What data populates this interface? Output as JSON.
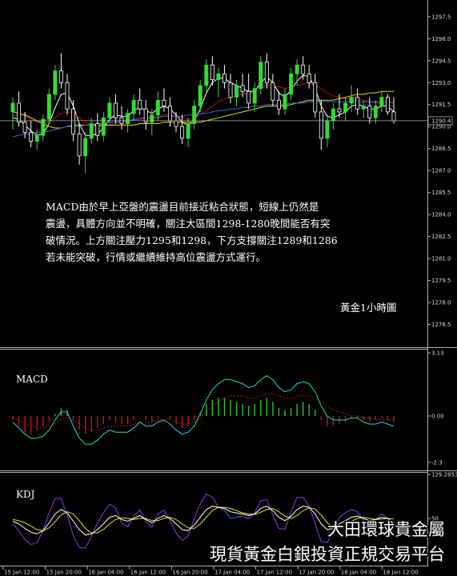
{
  "chart_data": [
    {
      "type": "candlestick",
      "title": "黃金1小時圖",
      "annotation": "MACD由於早上亞盤的震盪目前接近粘合狀態，短線上仍然是震盪，具體方向並不明確，關注大區間1298-1280晚間能否有突破情況。上方關注壓力1295和1298，下方支撐關注1289和1286若未能突破，行情或繼續維持高位震盪方式運行。",
      "annotation_lines": [
        "MACD由於早上亞盤的震盪目前接近粘合狀態，短線上仍然是",
        "震盪，具體方向並不明確，關注大區間1298-1280晚間能否有突",
        "破情況。上方關注壓力1295和1298，下方支撐關注1289和1286",
        "若未能突破，行情或繼續維持高位震盪方式運行。"
      ],
      "y_ticks": [
        "1297.5",
        "1296.0",
        "1294.5",
        "1293.0",
        "1291.5",
        "1290.0",
        "1288.5",
        "1287.0",
        "1285.5",
        "1284.0",
        "1282.5",
        "1281.0",
        "1279.5",
        "1278.0",
        "1276.5"
      ],
      "ylim": [
        1275.6,
        1298.2
      ],
      "current_price": "1290.4",
      "current_price_value": 1290.4,
      "x_ticks": [
        "15 Jan 12:00",
        "15 Jan 20:00",
        "16 Jan 04:00",
        "16 Jan 12:00",
        "16 Jan 20:00",
        "17 Jan 04:00",
        "17 Jan 12:00",
        "17 Jan 20:00",
        "18 Jan 04:00",
        "18 Jan 12:00"
      ],
      "candles": [
        {
          "o": 1291.0,
          "h": 1292.0,
          "l": 1289.8,
          "c": 1291.6
        },
        {
          "o": 1291.6,
          "h": 1292.4,
          "l": 1290.0,
          "c": 1290.3
        },
        {
          "o": 1290.3,
          "h": 1291.0,
          "l": 1289.2,
          "c": 1289.6
        },
        {
          "o": 1289.6,
          "h": 1290.4,
          "l": 1288.6,
          "c": 1289.0
        },
        {
          "o": 1289.0,
          "h": 1289.8,
          "l": 1288.4,
          "c": 1289.4
        },
        {
          "o": 1289.4,
          "h": 1290.8,
          "l": 1289.0,
          "c": 1290.5
        },
        {
          "o": 1290.5,
          "h": 1292.6,
          "l": 1290.2,
          "c": 1292.2
        },
        {
          "o": 1292.2,
          "h": 1294.2,
          "l": 1291.8,
          "c": 1293.8
        },
        {
          "o": 1293.8,
          "h": 1295.0,
          "l": 1292.6,
          "c": 1293.0
        },
        {
          "o": 1293.0,
          "h": 1293.6,
          "l": 1290.8,
          "c": 1291.2
        },
        {
          "o": 1291.2,
          "h": 1291.8,
          "l": 1289.0,
          "c": 1289.5
        },
        {
          "o": 1289.5,
          "h": 1290.2,
          "l": 1287.4,
          "c": 1288.0
        },
        {
          "o": 1288.0,
          "h": 1289.6,
          "l": 1286.8,
          "c": 1289.2
        },
        {
          "o": 1289.2,
          "h": 1290.6,
          "l": 1288.8,
          "c": 1290.2
        },
        {
          "o": 1290.2,
          "h": 1290.9,
          "l": 1289.0,
          "c": 1289.4
        },
        {
          "o": 1289.4,
          "h": 1291.0,
          "l": 1289.0,
          "c": 1290.6
        },
        {
          "o": 1290.6,
          "h": 1292.0,
          "l": 1290.2,
          "c": 1291.6
        },
        {
          "o": 1291.6,
          "h": 1292.2,
          "l": 1290.2,
          "c": 1290.6
        },
        {
          "o": 1290.6,
          "h": 1291.4,
          "l": 1289.8,
          "c": 1290.2
        },
        {
          "o": 1290.2,
          "h": 1291.2,
          "l": 1289.6,
          "c": 1290.9
        },
        {
          "o": 1290.9,
          "h": 1292.2,
          "l": 1290.4,
          "c": 1291.8
        },
        {
          "o": 1291.8,
          "h": 1292.6,
          "l": 1290.8,
          "c": 1291.2
        },
        {
          "o": 1291.2,
          "h": 1291.8,
          "l": 1289.8,
          "c": 1290.3
        },
        {
          "o": 1290.3,
          "h": 1291.2,
          "l": 1289.4,
          "c": 1290.8
        },
        {
          "o": 1290.8,
          "h": 1292.4,
          "l": 1290.4,
          "c": 1291.8
        },
        {
          "o": 1291.8,
          "h": 1292.6,
          "l": 1291.0,
          "c": 1291.4
        },
        {
          "o": 1291.4,
          "h": 1292.0,
          "l": 1290.0,
          "c": 1290.4
        },
        {
          "o": 1290.4,
          "h": 1291.0,
          "l": 1289.6,
          "c": 1290.0
        },
        {
          "o": 1290.0,
          "h": 1290.8,
          "l": 1288.8,
          "c": 1289.2
        },
        {
          "o": 1289.2,
          "h": 1290.6,
          "l": 1288.6,
          "c": 1290.2
        },
        {
          "o": 1290.2,
          "h": 1291.8,
          "l": 1289.8,
          "c": 1291.4
        },
        {
          "o": 1291.4,
          "h": 1293.2,
          "l": 1291.0,
          "c": 1292.8
        },
        {
          "o": 1292.8,
          "h": 1294.6,
          "l": 1292.4,
          "c": 1294.2
        },
        {
          "o": 1294.2,
          "h": 1294.8,
          "l": 1292.8,
          "c": 1293.2
        },
        {
          "o": 1293.2,
          "h": 1294.0,
          "l": 1292.0,
          "c": 1293.6
        },
        {
          "o": 1293.6,
          "h": 1294.2,
          "l": 1292.6,
          "c": 1293.0
        },
        {
          "o": 1293.0,
          "h": 1293.6,
          "l": 1291.6,
          "c": 1292.0
        },
        {
          "o": 1292.0,
          "h": 1293.2,
          "l": 1291.4,
          "c": 1292.8
        },
        {
          "o": 1292.8,
          "h": 1293.6,
          "l": 1292.0,
          "c": 1292.4
        },
        {
          "o": 1292.4,
          "h": 1293.6,
          "l": 1291.2,
          "c": 1291.6
        },
        {
          "o": 1291.6,
          "h": 1293.0,
          "l": 1291.0,
          "c": 1292.6
        },
        {
          "o": 1292.6,
          "h": 1294.8,
          "l": 1292.2,
          "c": 1294.4
        },
        {
          "o": 1294.4,
          "h": 1295.0,
          "l": 1292.6,
          "c": 1293.0
        },
        {
          "o": 1293.0,
          "h": 1293.6,
          "l": 1291.4,
          "c": 1291.8
        },
        {
          "o": 1291.8,
          "h": 1292.4,
          "l": 1290.8,
          "c": 1291.2
        },
        {
          "o": 1291.2,
          "h": 1292.6,
          "l": 1290.8,
          "c": 1292.2
        },
        {
          "o": 1292.2,
          "h": 1294.0,
          "l": 1291.8,
          "c": 1293.6
        },
        {
          "o": 1293.6,
          "h": 1294.6,
          "l": 1292.8,
          "c": 1294.2
        },
        {
          "o": 1294.2,
          "h": 1294.8,
          "l": 1293.2,
          "c": 1293.6
        },
        {
          "o": 1293.6,
          "h": 1294.2,
          "l": 1292.6,
          "c": 1293.0
        },
        {
          "o": 1293.0,
          "h": 1293.6,
          "l": 1290.6,
          "c": 1291.0
        },
        {
          "o": 1291.0,
          "h": 1291.8,
          "l": 1288.4,
          "c": 1289.2
        },
        {
          "o": 1289.2,
          "h": 1290.8,
          "l": 1288.6,
          "c": 1290.4
        },
        {
          "o": 1290.4,
          "h": 1291.6,
          "l": 1289.8,
          "c": 1291.2
        },
        {
          "o": 1291.2,
          "h": 1292.2,
          "l": 1290.6,
          "c": 1291.0
        },
        {
          "o": 1291.0,
          "h": 1292.0,
          "l": 1290.4,
          "c": 1291.6
        },
        {
          "o": 1291.6,
          "h": 1292.8,
          "l": 1291.0,
          "c": 1292.0
        },
        {
          "o": 1292.0,
          "h": 1292.6,
          "l": 1290.8,
          "c": 1291.2
        },
        {
          "o": 1291.2,
          "h": 1291.8,
          "l": 1290.6,
          "c": 1291.4
        },
        {
          "o": 1291.4,
          "h": 1292.0,
          "l": 1290.2,
          "c": 1290.6
        },
        {
          "o": 1290.6,
          "h": 1291.8,
          "l": 1290.2,
          "c": 1291.4
        },
        {
          "o": 1291.4,
          "h": 1292.4,
          "l": 1291.0,
          "c": 1292.0
        },
        {
          "o": 1292.0,
          "h": 1292.2,
          "l": 1290.8,
          "c": 1291.0
        },
        {
          "o": 1291.0,
          "h": 1292.0,
          "l": 1290.2,
          "c": 1290.4
        }
      ],
      "ma_series": [
        {
          "color": "#ffffff",
          "values": [
            1290.6,
            1290.5,
            1290.1,
            1289.7,
            1289.4,
            1289.5,
            1290.2,
            1291.3,
            1292.2,
            1292.3,
            1291.4,
            1290.2,
            1289.4,
            1289.4,
            1289.5,
            1289.9,
            1290.5,
            1290.8,
            1290.7,
            1290.7,
            1291.1,
            1291.3,
            1291.1,
            1290.9,
            1291.2,
            1291.4,
            1291.2,
            1290.8,
            1290.3,
            1290.1,
            1290.4,
            1291.2,
            1292.3,
            1293.0,
            1293.3,
            1293.3,
            1293.0,
            1292.8,
            1292.6,
            1292.4,
            1292.4,
            1293.0,
            1293.4,
            1293.0,
            1292.3,
            1292.0,
            1292.5,
            1293.1,
            1293.5,
            1293.4,
            1292.6,
            1291.4,
            1290.7,
            1290.6,
            1290.8,
            1291.0,
            1291.4,
            1291.5,
            1291.4,
            1291.2,
            1291.2,
            1291.4,
            1291.4,
            1291.0
          ]
        },
        {
          "color": "#b01010",
          "values": [
            1290.8,
            1290.8,
            1290.7,
            1290.5,
            1290.3,
            1290.2,
            1290.3,
            1290.6,
            1290.9,
            1291.0,
            1290.9,
            1290.6,
            1290.3,
            1290.1,
            1290.0,
            1290.0,
            1290.1,
            1290.2,
            1290.3,
            1290.4,
            1290.5,
            1290.6,
            1290.6,
            1290.6,
            1290.7,
            1290.8,
            1290.8,
            1290.7,
            1290.6,
            1290.5,
            1290.6,
            1290.8,
            1291.1,
            1291.4,
            1291.7,
            1291.9,
            1292.0,
            1292.1,
            1292.2,
            1292.3,
            1292.4,
            1292.6,
            1292.8,
            1292.8,
            1292.7,
            1292.6,
            1292.7,
            1292.8,
            1292.9,
            1293.0,
            1292.9,
            1292.6,
            1292.3,
            1292.1,
            1292.0,
            1291.9,
            1291.9,
            1291.9,
            1291.8,
            1291.7,
            1291.6,
            1291.6,
            1291.5,
            1291.4
          ]
        },
        {
          "color": "#e6d800",
          "values": [
            1291.0,
            1290.9,
            1290.8,
            1290.6,
            1290.4,
            1290.2,
            1290.0,
            1289.9,
            1289.9,
            1290.0,
            1290.1,
            1290.1,
            1290.1,
            1290.1,
            1290.1,
            1290.1,
            1290.1,
            1290.1,
            1290.1,
            1290.1,
            1290.1,
            1290.2,
            1290.2,
            1290.2,
            1290.2,
            1290.3,
            1290.3,
            1290.3,
            1290.3,
            1290.3,
            1290.3,
            1290.3,
            1290.4,
            1290.5,
            1290.6,
            1290.7,
            1290.8,
            1290.9,
            1291.0,
            1291.1,
            1291.2,
            1291.3,
            1291.4,
            1291.4,
            1291.4,
            1291.4,
            1291.5,
            1291.6,
            1291.7,
            1291.8,
            1291.8,
            1291.8,
            1291.8,
            1291.8,
            1291.9,
            1292.0,
            1292.1,
            1292.2,
            1292.2,
            1292.3,
            1292.3,
            1292.4,
            1292.4,
            1292.4
          ]
        },
        {
          "color": "#2a6edc",
          "values": [
            1289.3,
            1289.4,
            1289.5,
            1289.5,
            1289.6,
            1289.6,
            1289.7,
            1289.8,
            1289.9,
            1290.0,
            1290.0,
            1290.0,
            1290.1,
            1290.1,
            1290.2,
            1290.2,
            1290.3,
            1290.3,
            1290.4,
            1290.4,
            1290.5,
            1290.5,
            1290.6,
            1290.6,
            1290.6,
            1290.7,
            1290.7,
            1290.7,
            1290.7,
            1290.8,
            1290.8,
            1290.9,
            1290.9,
            1291.0,
            1291.1,
            1291.1,
            1291.2,
            1291.2,
            1291.3,
            1291.3,
            1291.4,
            1291.4,
            1291.5,
            1291.5,
            1291.5,
            1291.5,
            1291.6,
            1291.6,
            1291.6,
            1291.7,
            1291.7,
            1291.7,
            1291.7,
            1291.7,
            1291.7,
            1291.7,
            1291.7,
            1291.7,
            1291.7,
            1291.7,
            1291.7,
            1291.7,
            1291.7,
            1291.6
          ]
        }
      ]
    },
    {
      "type": "macd",
      "label": "MACD",
      "y_ticks": [
        "3.13",
        "0.00",
        "-2.3"
      ],
      "ylim": [
        -2.3,
        3.13
      ],
      "histogram": [
        -0.2,
        -0.5,
        -0.8,
        -0.9,
        -0.7,
        -0.5,
        -0.3,
        0.1,
        0.4,
        0.3,
        -0.3,
        -0.7,
        -0.9,
        -0.8,
        -0.6,
        -0.4,
        -0.2,
        -0.3,
        -0.4,
        -0.4,
        -0.2,
        0.0,
        -0.2,
        -0.3,
        -0.1,
        0.0,
        -0.2,
        -0.4,
        -0.6,
        -0.5,
        -0.2,
        0.2,
        0.6,
        0.8,
        0.9,
        0.9,
        0.8,
        0.7,
        0.6,
        0.5,
        0.6,
        0.8,
        0.9,
        0.7,
        0.4,
        0.3,
        0.4,
        0.6,
        0.7,
        0.6,
        0.3,
        -0.2,
        -0.5,
        -0.5,
        -0.4,
        -0.3,
        -0.1,
        -0.1,
        -0.2,
        -0.3,
        -0.2,
        -0.1,
        -0.2,
        -0.3
      ],
      "signal": [
        -0.1,
        -0.2,
        -0.4,
        -0.5,
        -0.6,
        -0.6,
        -0.5,
        -0.4,
        -0.2,
        -0.1,
        -0.2,
        -0.4,
        -0.6,
        -0.7,
        -0.7,
        -0.6,
        -0.5,
        -0.5,
        -0.5,
        -0.5,
        -0.4,
        -0.3,
        -0.3,
        -0.3,
        -0.2,
        -0.2,
        -0.2,
        -0.3,
        -0.4,
        -0.4,
        -0.3,
        -0.1,
        0.2,
        0.5,
        0.7,
        0.9,
        1.0,
        1.0,
        1.0,
        0.9,
        0.9,
        1.0,
        1.1,
        1.1,
        1.0,
        0.9,
        0.9,
        1.0,
        1.0,
        1.0,
        0.9,
        0.7,
        0.5,
        0.3,
        0.2,
        0.1,
        0.0,
        0.0,
        -0.1,
        -0.1,
        -0.2,
        -0.2,
        -0.2,
        -0.2
      ],
      "macd": [
        -0.3,
        -0.6,
        -0.9,
        -1.1,
        -1.1,
        -1.0,
        -0.7,
        -0.2,
        0.2,
        0.2,
        -0.5,
        -1.1,
        -1.4,
        -1.4,
        -1.2,
        -0.9,
        -0.7,
        -0.8,
        -0.8,
        -0.8,
        -0.6,
        -0.3,
        -0.5,
        -0.5,
        -0.3,
        -0.2,
        -0.4,
        -0.7,
        -0.9,
        -0.8,
        -0.5,
        0.1,
        0.8,
        1.3,
        1.6,
        1.8,
        1.8,
        1.7,
        1.6,
        1.4,
        1.5,
        1.8,
        2.0,
        1.8,
        1.4,
        1.2,
        1.3,
        1.6,
        1.7,
        1.6,
        1.2,
        0.5,
        0.0,
        -0.2,
        -0.2,
        -0.2,
        -0.1,
        -0.1,
        -0.3,
        -0.4,
        -0.4,
        -0.3,
        -0.4,
        -0.5
      ]
    },
    {
      "type": "kdj",
      "label": "KDJ",
      "y_ticks": [
        "129.2853",
        "50"
      ],
      "ylim": [
        -29.2853,
        129.2853
      ],
      "k": [
        45,
        40,
        32,
        25,
        22,
        28,
        42,
        58,
        66,
        60,
        45,
        30,
        20,
        22,
        30,
        40,
        52,
        55,
        48,
        45,
        50,
        55,
        48,
        42,
        50,
        55,
        50,
        40,
        30,
        28,
        38,
        52,
        66,
        72,
        70,
        68,
        62,
        60,
        58,
        55,
        58,
        68,
        72,
        64,
        52,
        46,
        54,
        66,
        72,
        70,
        58,
        40,
        30,
        32,
        40,
        46,
        52,
        54,
        50,
        46,
        48,
        52,
        50,
        44
      ],
      "d": [
        48,
        46,
        42,
        36,
        30,
        28,
        33,
        44,
        56,
        62,
        58,
        46,
        32,
        24,
        24,
        30,
        40,
        48,
        51,
        50,
        48,
        50,
        50,
        46,
        46,
        50,
        52,
        48,
        40,
        33,
        32,
        40,
        52,
        64,
        70,
        70,
        68,
        64,
        60,
        58,
        57,
        61,
        66,
        68,
        62,
        54,
        50,
        55,
        64,
        69,
        67,
        56,
        42,
        34,
        34,
        39,
        45,
        50,
        52,
        50,
        48,
        49,
        50,
        49
      ],
      "j": [
        40,
        28,
        12,
        3,
        6,
        28,
        60,
        86,
        86,
        56,
        19,
        -2,
        -4,
        18,
        42,
        60,
        76,
        69,
        42,
        35,
        54,
        65,
        44,
        34,
        58,
        65,
        46,
        24,
        10,
        18,
        50,
        76,
        94,
        88,
        70,
        64,
        50,
        52,
        54,
        49,
        60,
        82,
        84,
        56,
        32,
        30,
        62,
        88,
        88,
        72,
        40,
        8,
        6,
        28,
        52,
        60,
        66,
        62,
        46,
        38,
        48,
        58,
        50,
        34
      ]
    }
  ],
  "watermark": {
    "line1": "大田環球貴金屬",
    "line2": "現貨黃金白銀投資正規交易平台"
  },
  "colors": {
    "background": "#000000",
    "up_candle": "#32dc32",
    "down_candle": "#ffffff",
    "macd_bar_pos": "#2cc22c",
    "macd_bar_neg": "#c01818",
    "macd_line": "#20d6d6",
    "signal_line": "#c01818",
    "k_line": "#ffffff",
    "d_line": "#e6e600",
    "j_line": "#8a3ce0",
    "axis": "#b0b0b0",
    "current_price_line": "#b0b0b0"
  }
}
